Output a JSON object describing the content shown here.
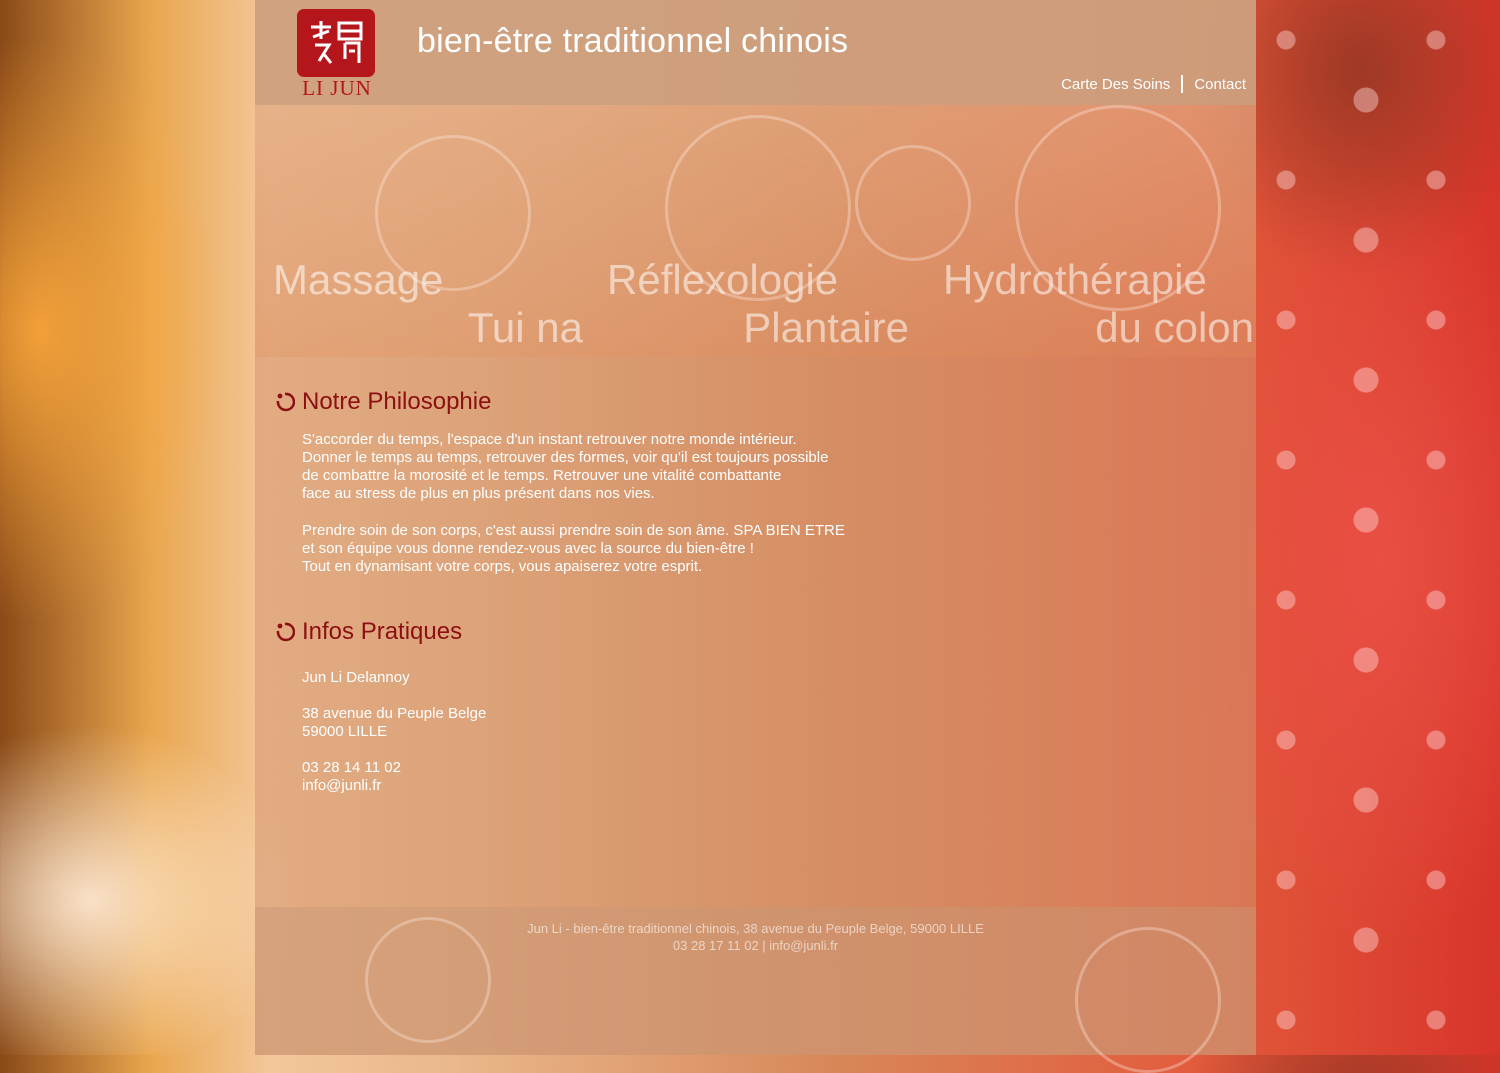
{
  "header": {
    "logo_text": "LI JUN",
    "site_title": "bien-être traditionnel chinois",
    "nav": [
      "Carte Des Soins",
      "Contact"
    ]
  },
  "banner": [
    {
      "line1": "Massage",
      "line2": "Tui na"
    },
    {
      "line1": "Réflexologie",
      "line2": "Plantaire"
    },
    {
      "line1": "Hydrothérapie",
      "line2": "du colon"
    }
  ],
  "philosophie": {
    "title": "Notre Philosophie",
    "p1": [
      "S'accorder du temps,  l'espace d'un instant retrouver notre monde intérieur.",
      "Donner le temps au temps, retrouver des formes, voir qu'il est toujours possible",
      "de combattre la morosité et le temps. Retrouver une vitalité combattante",
      "face au stress de plus en plus présent dans nos vies."
    ],
    "p2": [
      "Prendre soin de son corps, c'est aussi prendre soin de son âme. SPA BIEN ETRE",
      "et son équipe vous donne rendez-vous avec la source du bien-être !",
      "Tout en dynamisant votre corps, vous apaiserez votre esprit."
    ]
  },
  "infos": {
    "title": "Infos Pratiques",
    "name": "Jun Li Delannoy",
    "address1": "38 avenue du Peuple Belge",
    "address2": "59000 LILLE",
    "phone": "03 28 14 11 02",
    "email": "info@junli.fr"
  },
  "footer": {
    "line1": "Jun Li - bien-être traditionnel chinois,  38 avenue du Peuple Belge, 59000 LILLE",
    "line2": "03 28 17 11 02  |  info@junli.fr"
  },
  "colors": {
    "accent": "#8c0f12",
    "logo": "#b5161b"
  },
  "icons": [
    "logo-seal-icon",
    "swirl-bullet-icon"
  ]
}
